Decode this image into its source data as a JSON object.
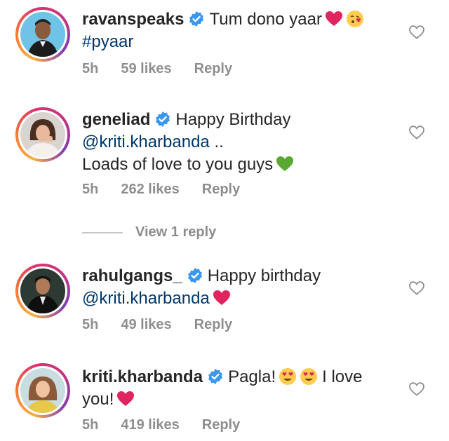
{
  "comments": [
    {
      "username": "ravanspeaks",
      "line1": "Tum dono yaar",
      "hashtag": "#pyaar",
      "time": "5h",
      "likes": "59 likes",
      "reply": "Reply"
    },
    {
      "username": "geneliad",
      "line1": "Happy Birthday",
      "mention": "@kriti.kharbanda",
      "mention_suffix": " ..",
      "line3": "Loads of love to you guys",
      "time": "5h",
      "likes": "262 likes",
      "reply": "Reply",
      "view_replies": "View 1 reply"
    },
    {
      "username": "rahulgangs_",
      "line1": "Happy birthday",
      "mention": "@kriti.kharbanda",
      "time": "5h",
      "likes": "49 likes",
      "reply": "Reply"
    },
    {
      "username": "kriti.kharbanda",
      "line1": "Pagla!",
      "line1_after": "I love",
      "line2": "you!",
      "time": "5h",
      "likes": "419 likes",
      "reply": "Reply"
    }
  ],
  "colors": {
    "verified": "#3897f0",
    "mention": "#00376b",
    "meta": "#8e8e8e",
    "heart_red": "#e0245e",
    "heart_green": "#5aa832"
  },
  "icons": {
    "verified": "verified-badge-icon",
    "like": "heart-outline-icon"
  }
}
